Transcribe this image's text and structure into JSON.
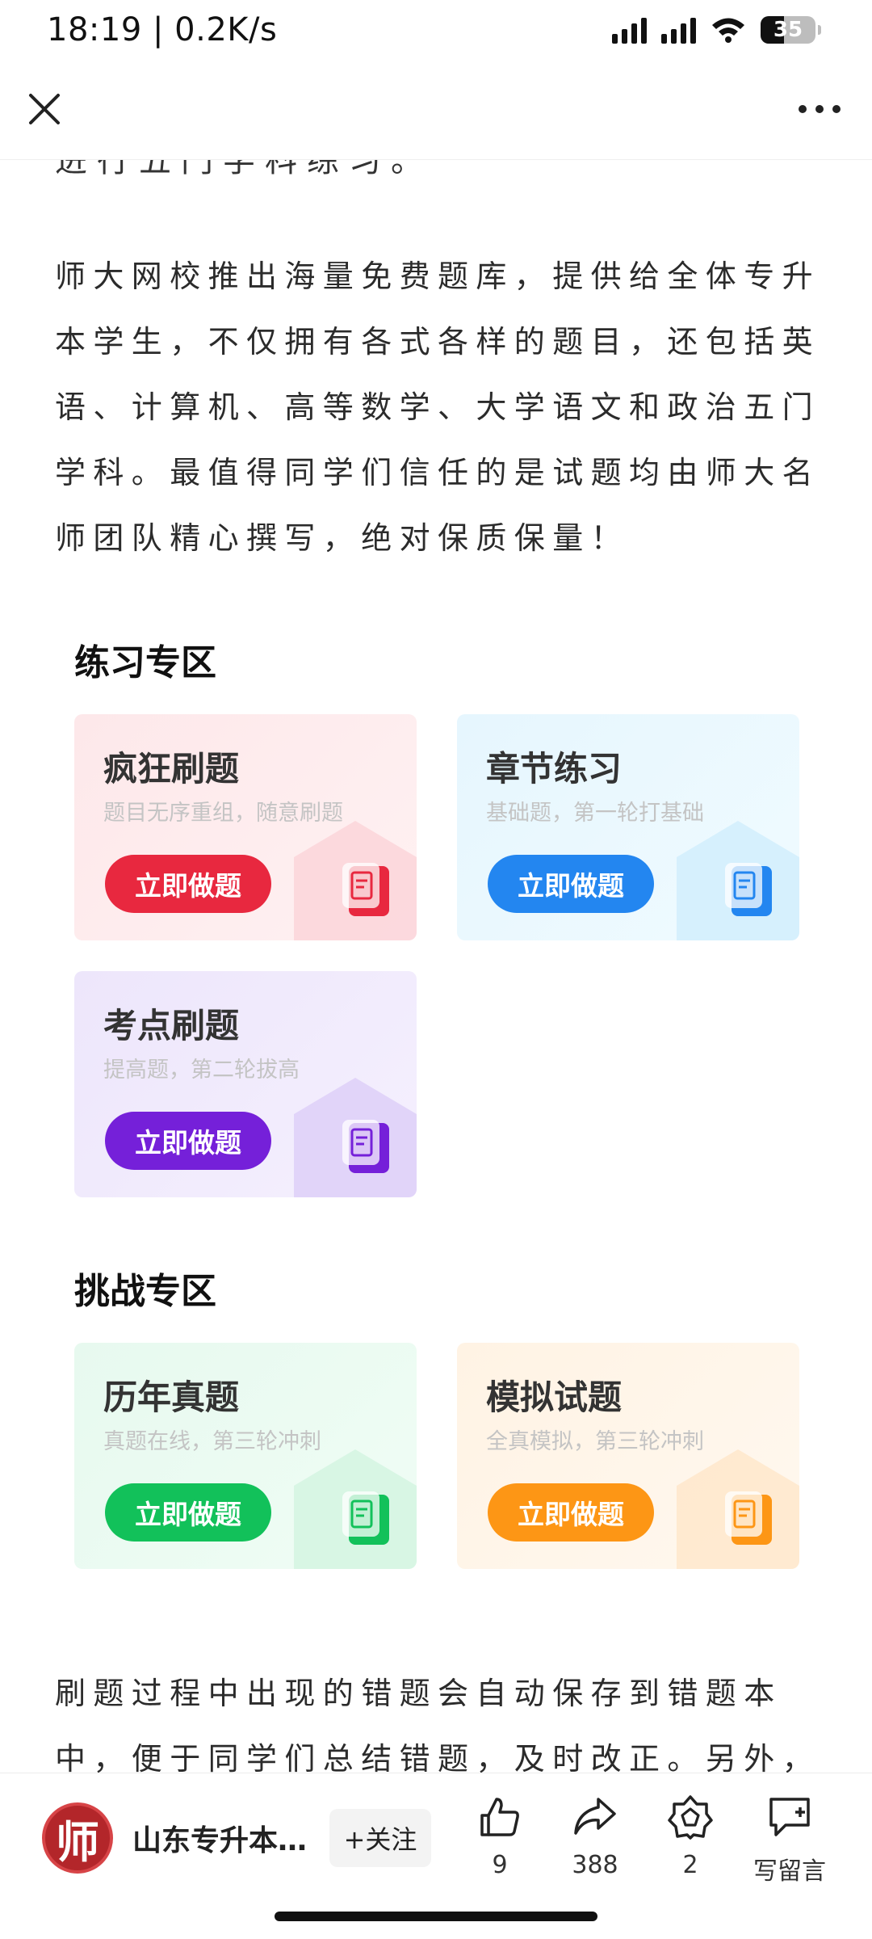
{
  "status_bar": {
    "time": "18:19 | 0.2K/s",
    "battery": "35"
  },
  "article": {
    "cut_line": "进行五门学科练习。",
    "paragraph1": "师大网校推出海量免费题库，提供给全体专升本学生，不仅拥有各式各样的题目，还包括英语、计算机、高等数学、大学语文和政治五门学科。最值得同学们信任的是试题均由师大名师团队精心撰写，绝对保质保量！",
    "paragraph2": "刷题过程中出现的错题会自动保存到错题本中，便于同学们总结错题，及时改正。另外，"
  },
  "practice_section": {
    "title": "练习专区",
    "cards": [
      {
        "title": "疯狂刷题",
        "subtitle": "题目无序重组，随意刷题",
        "button": "立即做题",
        "color": "#e8283f",
        "icon": "document-icon"
      },
      {
        "title": "章节练习",
        "subtitle": "基础题，第一轮打基础",
        "button": "立即做题",
        "color": "#2386f0",
        "icon": "document-icon"
      },
      {
        "title": "考点刷题",
        "subtitle": "提高题，第二轮拔高",
        "button": "立即做题",
        "color": "#7520d9",
        "icon": "document-icon"
      }
    ]
  },
  "challenge_section": {
    "title": "挑战专区",
    "cards": [
      {
        "title": "历年真题",
        "subtitle": "真题在线，第三轮冲刺",
        "button": "立即做题",
        "color": "#12c15a",
        "icon": "document-icon"
      },
      {
        "title": "模拟试题",
        "subtitle": "全真模拟，第三轮冲刺",
        "button": "立即做题",
        "color": "#fd9615",
        "icon": "document-icon"
      }
    ]
  },
  "bottom_bar": {
    "avatar_char": "师",
    "author": "山东专升本…",
    "follow": "+关注",
    "like_count": "9",
    "share_count": "388",
    "recommend_count": "2",
    "comment_label": "写留言"
  }
}
